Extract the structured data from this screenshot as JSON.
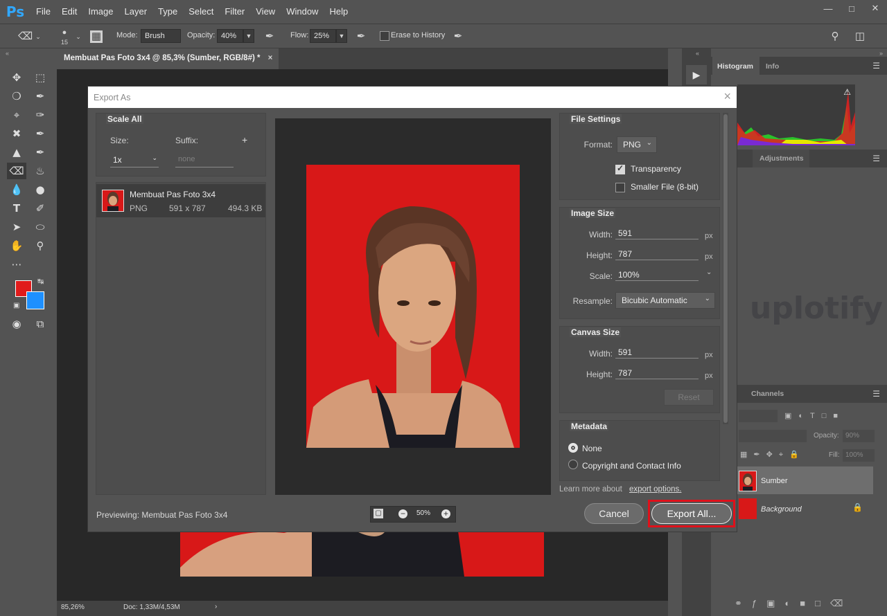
{
  "menubar": {
    "logo": "Ps",
    "items": [
      "File",
      "Edit",
      "Image",
      "Layer",
      "Type",
      "Select",
      "Filter",
      "View",
      "Window",
      "Help"
    ]
  },
  "options_bar": {
    "brush_size": "15",
    "mode_label": "Mode:",
    "mode_value": "Brush",
    "opacity_label": "Opacity:",
    "opacity_value": "40%",
    "flow_label": "Flow:",
    "flow_value": "25%",
    "erase_history_label": "Erase to History"
  },
  "document": {
    "tab_title": "Membuat Pas Foto 3x4 @ 85,3% (Sumber, RGB/8#) *",
    "zoom": "85,26%",
    "doc_info": "Doc: 1,33M/4,53M"
  },
  "colors": {
    "foreground": "#e01b1b",
    "background": "#1e90ff",
    "photo_bg": "#d81818",
    "highlight": "#e0101a"
  },
  "right_panel": {
    "tab_histogram": "Histogram",
    "tab_info": "Info",
    "tab_properties_partial": "es",
    "tab_adjustments": "Adjustments",
    "tab_channels": "Channels",
    "opacity_label": "Opacity:",
    "opacity_value": "90%",
    "fill_label": "Fill:",
    "fill_value": "100%",
    "layers": [
      {
        "name": "Sumber"
      },
      {
        "name": "Background"
      }
    ],
    "watermark": "uplotify"
  },
  "dialog": {
    "title": "Export As",
    "scale_all": {
      "title": "Scale All",
      "size_label": "Size:",
      "suffix_label": "Suffix:",
      "size_value": "1x",
      "suffix_placeholder": "none",
      "add": "+"
    },
    "asset": {
      "name": "Membuat Pas Foto 3x4",
      "format": "PNG",
      "dimensions": "591 x 787",
      "filesize": "494.3 KB"
    },
    "file_settings": {
      "title": "File Settings",
      "format_label": "Format:",
      "format_value": "PNG",
      "transparency_label": "Transparency",
      "transparency_checked": true,
      "smaller_file_label": "Smaller File (8-bit)",
      "smaller_file_checked": false
    },
    "image_size": {
      "title": "Image Size",
      "width_label": "Width:",
      "width_value": "591",
      "height_label": "Height:",
      "height_value": "787",
      "scale_label": "Scale:",
      "scale_value": "100%",
      "resample_label": "Resample:",
      "resample_value": "Bicubic Automatic",
      "unit": "px"
    },
    "canvas_size": {
      "title": "Canvas Size",
      "width_label": "Width:",
      "width_value": "591",
      "height_label": "Height:",
      "height_value": "787",
      "unit": "px",
      "reset_label": "Reset"
    },
    "metadata": {
      "title": "Metadata",
      "options": [
        "None",
        "Copyright and Contact Info"
      ],
      "selected": "None"
    },
    "learn_more_text": "Learn more about",
    "learn_more_link": "export options.",
    "previewing": "Previewing: Membuat Pas Foto 3x4",
    "zoom_value": "50%",
    "cancel_label": "Cancel",
    "export_label": "Export All..."
  }
}
